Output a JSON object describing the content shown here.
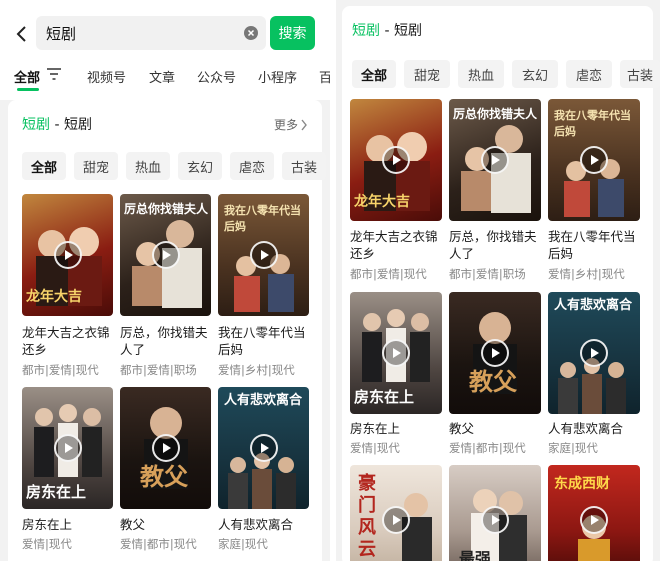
{
  "search": {
    "query": "短剧",
    "button": "搜索"
  },
  "filter_tabs": [
    {
      "label": "全部"
    },
    {
      "label": "视频号"
    },
    {
      "label": "文章"
    },
    {
      "label": "公众号"
    },
    {
      "label": "小程序"
    },
    {
      "label": "百"
    }
  ],
  "section": {
    "category": "短剧",
    "separator": " - ",
    "name": "短剧",
    "more": "更多"
  },
  "genres": [
    "全部",
    "甜宠",
    "热血",
    "玄幻",
    "虐恋",
    "古装"
  ],
  "dramas": [
    {
      "title_line1": "龙年大吉之衣锦",
      "title_line2": "还乡",
      "tags": "都市|爱情|现代",
      "poster_text": "龙年大吉"
    },
    {
      "title_line1": "厉总，你找错夫",
      "title_line2": "人了",
      "tags": "都市|爱情|职场",
      "poster_text": "厉总你找错夫人"
    },
    {
      "title_line1": "我在八零年代当",
      "title_line2": "后妈",
      "tags": "爱情|乡村|现代",
      "poster_text": "我在八零年代当后妈"
    },
    {
      "title_line1": "房东在上",
      "title_line2": "",
      "tags": "爱情|现代",
      "poster_text": "房东在上"
    },
    {
      "title_line1": "教父",
      "title_line2": "",
      "tags": "爱情|都市|现代",
      "poster_text": "教父"
    },
    {
      "title_line1": "人有悲欢离合",
      "title_line2": "",
      "tags": "家庭|现代",
      "poster_text": "人有悲欢离合"
    }
  ],
  "extra_posters": [
    {
      "poster_text": "豪门风云"
    },
    {
      "poster_text": "最强"
    },
    {
      "poster_text": "东成西财"
    }
  ],
  "colors": {
    "accent": "#07c160",
    "background": "#f2f2f2",
    "card": "#ffffff",
    "chip": "#f3f3f3",
    "tag_text": "#888888"
  },
  "icons": {
    "back": "chevron-left-icon",
    "clear": "clear-icon",
    "filter": "filter-icon",
    "more": "chevron-right-icon",
    "play": "play-icon"
  }
}
